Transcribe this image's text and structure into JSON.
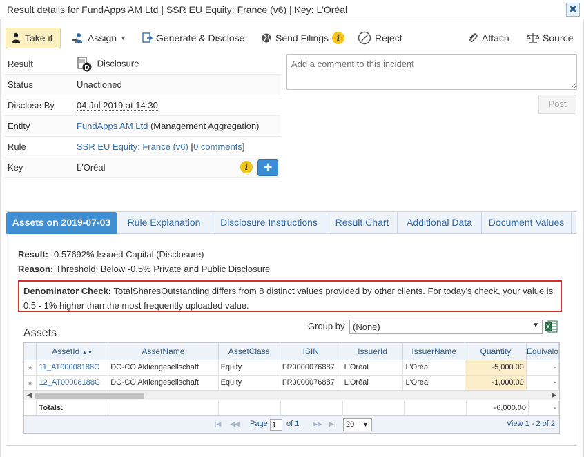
{
  "window": {
    "title": "Result details for FundApps AM Ltd | SSR EU Equity: France (v6) | Key: L'Oréal",
    "close_label": "✖"
  },
  "toolbar": {
    "take_it": "Take it",
    "assign": "Assign",
    "generate": "Generate & Disclose",
    "send_filings": "Send Filings",
    "reject": "Reject",
    "attach": "Attach",
    "source": "Source"
  },
  "details": {
    "result_label": "Result",
    "result_value": "Disclosure",
    "status_label": "Status",
    "status_value": "Unactioned",
    "disclose_label": "Disclose By",
    "disclose_value": "04 Jul 2019 at 14:30",
    "entity_label": "Entity",
    "entity_link": "FundApps AM Ltd",
    "entity_suffix": "(Management Aggregation)",
    "rule_label": "Rule",
    "rule_link": "SSR EU Equity: France (v6)",
    "rule_open": "[",
    "rule_comments": "0 comments",
    "rule_close": "]",
    "key_label": "Key",
    "key_value": "L'Oréal"
  },
  "comment": {
    "placeholder": "Add a comment to this incident",
    "post_label": "Post"
  },
  "tabs": [
    "Assets on 2019-07-03",
    "Rule Explanation",
    "Disclosure Instructions",
    "Result Chart",
    "Additional Data",
    "Document Values"
  ],
  "summary": {
    "result_label": "Result:",
    "result_text": "-0.57692% Issued Capital (Disclosure)",
    "reason_label": "Reason:",
    "reason_text": "Threshold: Below -0.5% Private and Public Disclosure",
    "denom_label": "Denominator Check:",
    "denom_text": "TotalSharesOutstanding differs from 8 distinct values provided by other clients. For today's check, your value is 0.5 - 1% higher than the most frequently uploaded value."
  },
  "assets": {
    "heading": "Assets",
    "group_by_label": "Group by",
    "group_by_value": "(None)",
    "columns": [
      "AssetId",
      "AssetName",
      "AssetClass",
      "ISIN",
      "IssuerId",
      "IssuerName",
      "Quantity",
      "Equivalo"
    ],
    "rows": [
      [
        "11_AT00008188C",
        "DO-CO Aktiengesellschaft",
        "Equity",
        "FR0000076887",
        "L'Oréal",
        "L'Oréal",
        "-5,000.00",
        "-"
      ],
      [
        "12_AT00008188C",
        "DO-CO Aktiengesellschaft",
        "Equity",
        "FR0000076887",
        "L'Oréal",
        "L'Oréal",
        "-1,000.00",
        "-"
      ]
    ],
    "totals_label": "Totals:",
    "totals_quantity": "-6,000.00",
    "totals_equiv": "-"
  },
  "pager": {
    "page_label": "Page",
    "page_value": "1",
    "of_label": "of 1",
    "page_size": "20",
    "view_text": "View 1 - 2 of 2"
  },
  "colors": {
    "accent": "#3f8fd2",
    "link": "#3a6ea5",
    "highlight_border": "#d32f2f",
    "quantity_bg": "#fdeecb",
    "active_button": "#fbf1c0"
  }
}
